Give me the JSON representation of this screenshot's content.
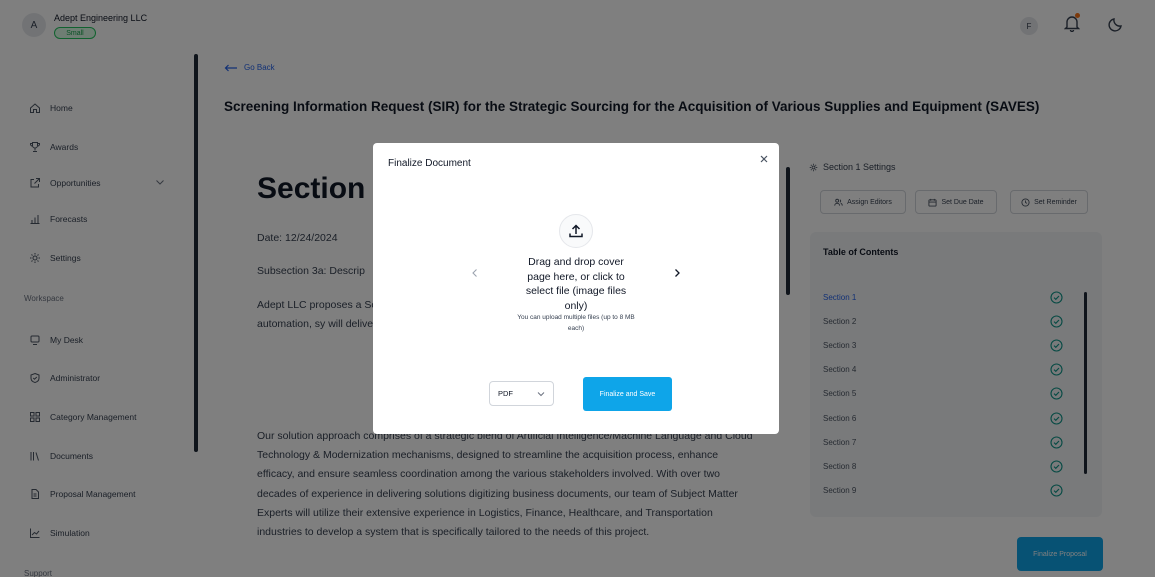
{
  "header": {
    "org_initial": "A",
    "org_name": "Adept Engineering LLC",
    "plan_badge": "Small",
    "user_initial": "F",
    "icons": [
      "bell-icon",
      "moon-icon"
    ],
    "notification_dot_color": "#f97316"
  },
  "sidebar": {
    "items": [
      {
        "label": "Home",
        "icon": "home-icon"
      },
      {
        "label": "Awards",
        "icon": "trophy-icon"
      },
      {
        "label": "Opportunities",
        "icon": "external-link-icon"
      },
      {
        "label": "Forecasts",
        "icon": "chart-icon"
      },
      {
        "label": "Settings",
        "icon": "gear-icon"
      }
    ],
    "workspace_label": "Workspace",
    "workspace_items": [
      {
        "label": "My Desk",
        "icon": "desk-icon"
      },
      {
        "label": "Administrator",
        "icon": "shield-icon"
      },
      {
        "label": "Category Management",
        "icon": "grid-icon"
      },
      {
        "label": "Documents",
        "icon": "books-icon"
      },
      {
        "label": "Proposal Management",
        "icon": "file-icon"
      },
      {
        "label": "Simulation",
        "icon": "chart-line-icon"
      }
    ],
    "support_label": "Support"
  },
  "main": {
    "back_label": "Go Back",
    "page_title": "Screening Information Request (SIR) for the Strategic Sourcing for the Acquisition of Various Supplies and Equipment (SAVES)",
    "document": {
      "heading": "Section",
      "date": "Date: 12/24/2024",
      "subsection": "Subsection 3a: Descrip",
      "para1": "Adept  LLC proposes a[...] Screening Information [...] Supplies and Equipmer[...] electronic data interch[...] process automation, sy[...] will deliver a solution th[...]",
      "para1_visible": "Adept  LLC proposes a Screening Information Supplies and Equipmer electronic data interch process automation, sy will deliver a solution th",
      "para2": "Our solution approach comprises of a strategic blend of Artificial Intelligence/Machine Language and Cloud Technology & Modernization mechanisms, designed to streamline the acquisition process, enhance efficacy, and ensure seamless coordination among the various stakeholders involved. With over two decades of experience in delivering solutions digitizing business documents, our team of Subject Matter Experts will utilize their extensive experience in Logistics, Finance, Healthcare, and Transportation industries to develop a system that is specifically tailored to the needs of this project."
    }
  },
  "right_panel": {
    "settings_title": "Section 1 Settings",
    "buttons": {
      "assign_editors": "Assign Editors",
      "set_due_date": "Set Due Date",
      "set_reminder": "Set Reminder"
    },
    "toc_title": "Table of Contents",
    "toc_items": [
      "Section 1",
      "Section 2",
      "Section 3",
      "Section 4",
      "Section 5",
      "Section 6",
      "Section 7",
      "Section 8",
      "Section 9"
    ],
    "finalize_proposal": "Finalize Proposal",
    "accent_color": "#0ea5e9"
  },
  "modal": {
    "title": "Finalize Document",
    "drop_text": "Drag and drop cover page here, or click to select file (image files only)",
    "drop_hint": "You can upload multiple files (up to 8 MB each)",
    "format_value": "PDF",
    "finalize_label": "Finalize and Save",
    "icons": [
      "upload-icon",
      "close-icon",
      "chevron-left-icon",
      "chevron-right-icon",
      "chevron-down-icon"
    ]
  }
}
